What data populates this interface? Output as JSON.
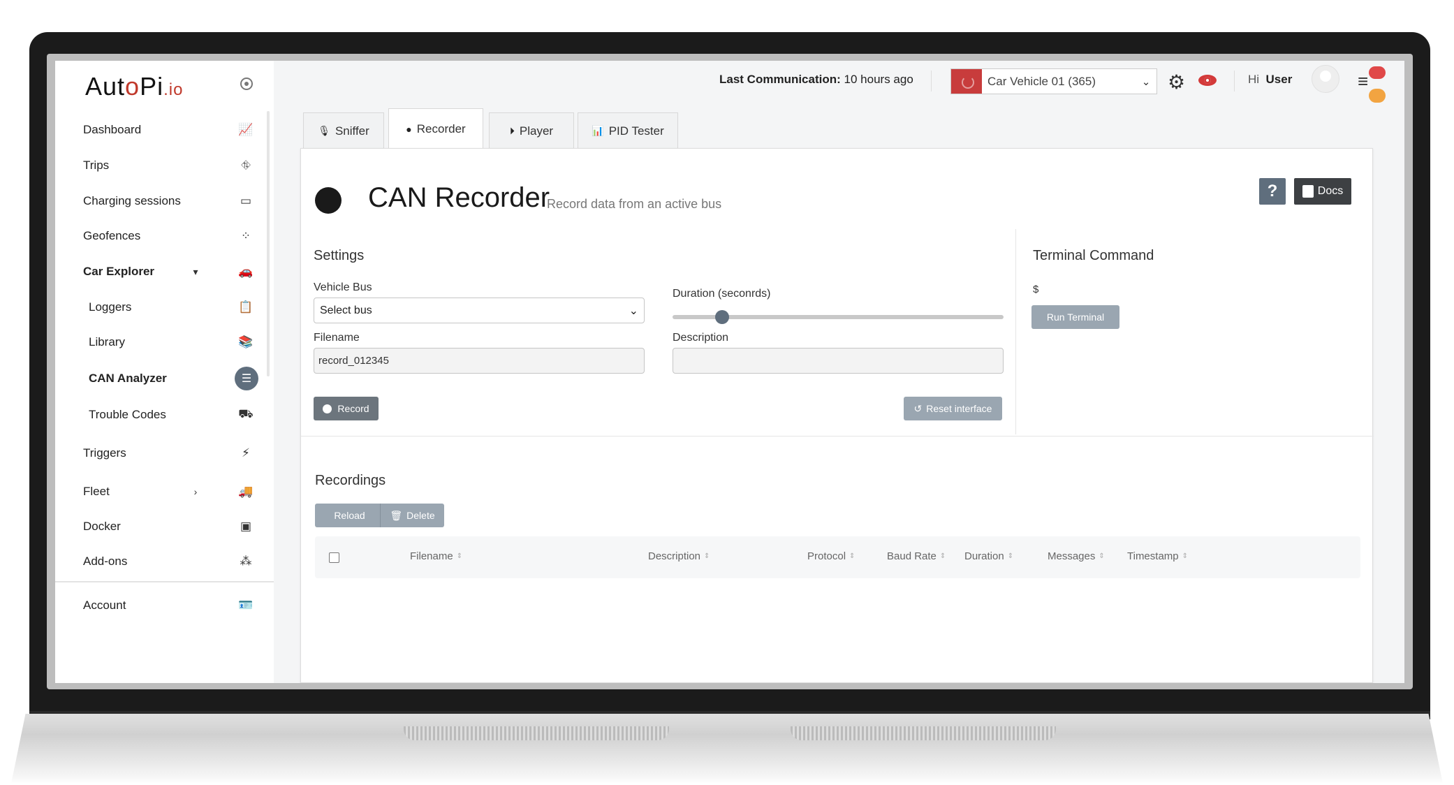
{
  "brand": {
    "logo_main": "Aut",
    "logo_o": "o",
    "logo_pi": "Pi",
    "logo_suffix": ".io"
  },
  "sidebar": {
    "items": [
      {
        "label": "Dashboard",
        "icon": "chart-line-icon"
      },
      {
        "label": "Trips",
        "icon": "map-marker-icon"
      },
      {
        "label": "Charging sessions",
        "icon": "battery-icon"
      },
      {
        "label": "Geofences",
        "icon": "geofence-icon"
      },
      {
        "label": "Car Explorer",
        "icon": "car-icon"
      },
      {
        "label": "Loggers",
        "icon": "clipboard-icon"
      },
      {
        "label": "Library",
        "icon": "library-icon"
      },
      {
        "label": "CAN Analyzer",
        "icon": "sliders-icon"
      },
      {
        "label": "Trouble Codes",
        "icon": "car-crash-icon"
      },
      {
        "label": "Triggers",
        "icon": "bolt-icon"
      },
      {
        "label": "Fleet",
        "icon": "truck-icon"
      },
      {
        "label": "Docker",
        "icon": "box-icon"
      },
      {
        "label": "Add-ons",
        "icon": "cubes-icon"
      },
      {
        "label": "Account",
        "icon": "id-card-icon"
      }
    ]
  },
  "topbar": {
    "last_comm_label": "Last Communication:",
    "last_comm_value": "10 hours ago",
    "vehicle": "Car Vehicle 01 (365)",
    "greeting": "Hi",
    "user": "User"
  },
  "tabs": [
    {
      "label": "Sniffer",
      "icon": "microphone-icon"
    },
    {
      "label": "Recorder",
      "icon": "record-icon",
      "active": true
    },
    {
      "label": "Player",
      "icon": "play-circle-icon"
    },
    {
      "label": "PID Tester",
      "icon": "bar-chart-icon"
    }
  ],
  "card": {
    "title": "CAN Recorder",
    "subtitle": "Record data from an active bus",
    "docs_label": "Docs",
    "help_label": "?"
  },
  "settings": {
    "title": "Settings",
    "vehicle_bus_label": "Vehicle Bus",
    "vehicle_bus_value": "Select bus",
    "duration_label": "Duration (seconrds)",
    "duration_fraction": 0.15,
    "filename_label": "Filename",
    "filename_value": "record_012345",
    "description_label": "Description",
    "description_value": "",
    "record_button": "Record",
    "reset_button": "Reset interface"
  },
  "terminal": {
    "title": "Terminal Command",
    "prompt": "$",
    "run_button": "Run Terminal"
  },
  "recordings": {
    "title": "Recordings",
    "reload_button": "Reload",
    "delete_button": "Delete",
    "columns": [
      "Filename",
      "Description",
      "Protocol",
      "Baud Rate",
      "Duration",
      "Messages",
      "Timestamp"
    ]
  },
  "colors": {
    "accent": "#5f6e7d",
    "brand_red": "#c0392b",
    "vehicle_swatch": "#c83c3c"
  }
}
